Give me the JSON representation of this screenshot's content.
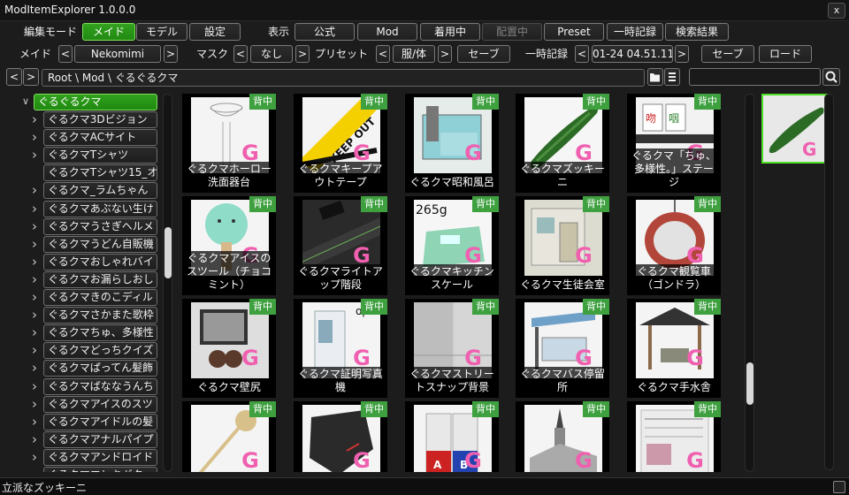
{
  "window": {
    "title": "ModItemExplorer 1.0.0.0",
    "close_label": "x"
  },
  "toolbar1": {
    "edit_mode_label": "編集モード",
    "mode_maid": "メイド",
    "mode_model": "モデル",
    "mode_settings": "設定",
    "display_label": "表示",
    "filter_official": "公式",
    "filter_mod": "Mod",
    "filter_wearing": "着用中",
    "filter_placed": "配置中",
    "filter_preset": "Preset",
    "filter_temp": "一時記録",
    "filter_search": "検索結果"
  },
  "toolbar2": {
    "maid_label": "メイド",
    "maid_value": "Nekomimi",
    "mask_label": "マスク",
    "mask_value": "なし",
    "preset_label": "プリセット",
    "preset_value": "服/体",
    "preset_save": "セーブ",
    "temp_label": "一時記録",
    "temp_value": "01-24 04.51.11",
    "temp_save": "セーブ",
    "temp_load": "ロード",
    "prev": "<",
    "next": ">"
  },
  "pathbar": {
    "path": "Root \\ Mod \\ ぐるぐるクマ"
  },
  "tree": {
    "root": "ぐるぐるクマ",
    "items": [
      "ぐるクマ3Dビジョン",
      "ぐるクマACサイト",
      "ぐるクマTシャツ",
      "ぐるクマTシャツ15_オ",
      "ぐるクマ_ラムちゃん",
      "ぐるクマあぶない生け",
      "ぐるクマうさぎヘルメ",
      "ぐるクマうどん自販機",
      "ぐるクマおしゃれバイ",
      "ぐるクマお漏らしおし",
      "ぐるクマきのこディル",
      "ぐるクマさかまた歌枠",
      "ぐるクマちゅ、多様性",
      "ぐるクマどっちクイズ",
      "ぐるクマぱってん髪飾",
      "ぐるクマばななうんち",
      "ぐるクマアイスのスツ",
      "ぐるクマアイドルの髪",
      "ぐるクマアナルパイプ",
      "ぐるクマアンドロイド",
      "ぐるクマエレキギター"
    ]
  },
  "grid": {
    "badge": "背中",
    "g_mark": "G",
    "items": [
      {
        "name": "ぐるクマホーロー洗面器台",
        "icon": "washbasin-stand-icon"
      },
      {
        "name": "ぐるクマキープアウトテープ",
        "icon": "keep-out-tape-icon",
        "thumb_text": "KEEP OUT"
      },
      {
        "name": "ぐるクマ昭和風呂",
        "icon": "bathtub-icon"
      },
      {
        "name": "ぐるクマズッキーニ",
        "icon": "zucchini-icon"
      },
      {
        "name": "ぐるクマ「ちゅ、多様性。」ステージ",
        "icon": "mahjong-stage-icon"
      },
      {
        "name": "ぐるクマアイスのスツール（チョコミント）",
        "icon": "ice-stool-icon"
      },
      {
        "name": "ぐるクマライトアップ階段",
        "icon": "lightup-stairs-icon"
      },
      {
        "name": "ぐるクマキッチンスケール",
        "icon": "kitchen-scale-icon",
        "thumb_text": "265g"
      },
      {
        "name": "ぐるクマ生徒会室",
        "icon": "student-council-room-icon"
      },
      {
        "name": "ぐるクマ観覧車（ゴンドラ）",
        "icon": "ferris-gondola-icon"
      },
      {
        "name": "ぐるクマ壁尻",
        "icon": "wall-icon"
      },
      {
        "name": "ぐるクマ証明写真機",
        "icon": "photo-booth-icon",
        "thumb_text": "ope"
      },
      {
        "name": "ぐるクマストリートスナップ背景",
        "icon": "street-background-icon"
      },
      {
        "name": "ぐるクマバス停留所",
        "icon": "bus-stop-icon"
      },
      {
        "name": "ぐるクマ手水舎",
        "icon": "temizuya-icon"
      },
      {
        "name": "",
        "icon": "ladle-icon"
      },
      {
        "name": "",
        "icon": "black-object-icon"
      },
      {
        "name": "",
        "icon": "binders-icon",
        "thumb_text": "A B"
      },
      {
        "name": "",
        "icon": "church-icon"
      },
      {
        "name": "",
        "icon": "newspaper-icon"
      }
    ]
  },
  "preview": {
    "icon": "zucchini-icon"
  },
  "status": {
    "text": "立派なズッキーニ"
  },
  "colors": {
    "accent_green": "#2f9a1c",
    "badge_green": "#3fa040",
    "g_pink": "#f060b0"
  }
}
